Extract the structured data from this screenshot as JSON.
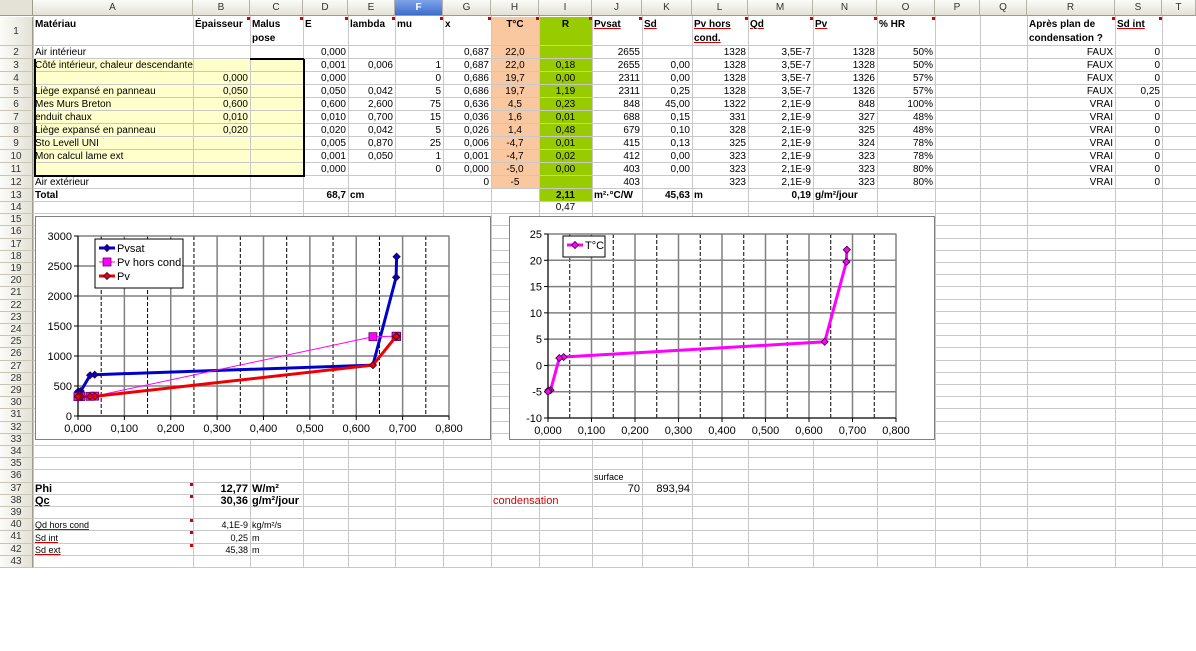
{
  "spreadsheet": {
    "columns": [
      "A",
      "B",
      "C",
      "D",
      "E",
      "F",
      "G",
      "H",
      "I",
      "J",
      "K",
      "L",
      "M",
      "N",
      "O",
      "P",
      "Q",
      "R",
      "S",
      "T"
    ],
    "selected_column": "F",
    "row_count": 43,
    "cells": {
      "A1": "Matériau",
      "B1": "Épaisseur",
      "C1": "Malus pose",
      "D1": "E",
      "E1": "lambda",
      "F1": "mu",
      "G1": "x",
      "H1": "T°C",
      "I1": "R",
      "J1": "Pvsat",
      "K1": "Sd",
      "L1": "Pv hors cond.",
      "M1": "Qd",
      "N1": "Pv",
      "O1": "% HR",
      "R1": "Après plan de condensation ?",
      "S1": "Sd int",
      "A2": "Air intérieur",
      "D2": "0,000",
      "G2": "0,687",
      "H2": "22,0",
      "J2": "2655",
      "L2": "1328",
      "M2": "3,5E-7",
      "N2": "1328",
      "O2": "50%",
      "R2": "FAUX",
      "S2": "0",
      "A3": "Côté intérieur, chaleur descendante",
      "D3": "0,001",
      "E3": "0,006",
      "F3": "1",
      "G3": "0,687",
      "H3": "22,0",
      "I3": "0,18",
      "J3": "2655",
      "K3": "0,00",
      "L3": "1328",
      "M3": "3,5E-7",
      "N3": "1328",
      "O3": "50%",
      "R3": "FAUX",
      "S3": "0",
      "B4": "0,000",
      "D4": "0,000",
      "F4": "0",
      "G4": "0,686",
      "H4": "19,7",
      "I4": "0,00",
      "J4": "2311",
      "K4": "0,00",
      "L4": "1328",
      "M4": "3,5E-7",
      "N4": "1326",
      "O4": "57%",
      "R4": "FAUX",
      "S4": "0",
      "A5": "Liège expansé en panneau",
      "B5": "0,050",
      "D5": "0,050",
      "E5": "0,042",
      "F5": "5",
      "G5": "0,686",
      "H5": "19,7",
      "I5": "1,19",
      "J5": "2311",
      "K5": "0,25",
      "L5": "1328",
      "M5": "3,5E-7",
      "N5": "1326",
      "O5": "57%",
      "R5": "FAUX",
      "S5": "0,25",
      "A6": "Mes Murs Breton",
      "B6": "0,600",
      "D6": "0,600",
      "E6": "2,600",
      "F6": "75",
      "G6": "0,636",
      "H6": "4,5",
      "I6": "0,23",
      "J6": "848",
      "K6": "45,00",
      "L6": "1322",
      "M6": "2,1E-9",
      "N6": "848",
      "O6": "100%",
      "R6": "VRAI",
      "S6": "0",
      "A7": "enduit chaux",
      "B7": "0,010",
      "D7": "0,010",
      "E7": "0,700",
      "F7": "15",
      "G7": "0,036",
      "H7": "1,6",
      "I7": "0,01",
      "J7": "688",
      "K7": "0,15",
      "L7": "331",
      "M7": "2,1E-9",
      "N7": "327",
      "O7": "48%",
      "R7": "VRAI",
      "S7": "0",
      "A8": "Liège expansé en panneau",
      "B8": "0,020",
      "D8": "0,020",
      "E8": "0,042",
      "F8": "5",
      "G8": "0,026",
      "H8": "1,4",
      "I8": "0,48",
      "J8": "679",
      "K8": "0,10",
      "L8": "328",
      "M8": "2,1E-9",
      "N8": "325",
      "O8": "48%",
      "R8": "VRAI",
      "S8": "0",
      "A9": "Sto Levell UNI",
      "D9": "0,005",
      "E9": "0,870",
      "F9": "25",
      "G9": "0,006",
      "H9": "-4,7",
      "I9": "0,01",
      "J9": "415",
      "K9": "0,13",
      "L9": "325",
      "M9": "2,1E-9",
      "N9": "324",
      "O9": "78%",
      "R9": "VRAI",
      "S9": "0",
      "A10": "Mon calcul lame ext",
      "D10": "0,001",
      "E10": "0,050",
      "F10": "1",
      "G10": "0,001",
      "H10": "-4,7",
      "I10": "0,02",
      "J10": "412",
      "K10": "0,00",
      "L10": "323",
      "M10": "2,1E-9",
      "N10": "323",
      "O10": "78%",
      "R10": "VRAI",
      "S10": "0",
      "D11": "0,000",
      "F11": "0",
      "G11": "0,000",
      "H11": "-5,0",
      "I11": "0,00",
      "J11": "403",
      "K11": "0,00",
      "L11": "323",
      "M11": "2,1E-9",
      "N11": "323",
      "O11": "80%",
      "R11": "VRAI",
      "S11": "0",
      "A12": "Air extérieur",
      "G12": "0",
      "H12": "-5",
      "J12": "403",
      "L12": "323",
      "M12": "2,1E-9",
      "N12": "323",
      "O12": "80%",
      "R12": "VRAI",
      "S12": "0",
      "A13": "Total",
      "D13": "68,7",
      "E13": "cm",
      "I13": "2,11",
      "J13": "m²·°C/W",
      "K13": "45,63",
      "L13": "m",
      "M13": "0,19",
      "N13": "g/m²/jour",
      "I14": "0,47",
      "J36": "surface",
      "A37": "Phi",
      "B37": "12,77",
      "C37": "W/m²",
      "J37": "70",
      "K37": "893,94",
      "A38": "Qc",
      "B38": "30,36",
      "C38": "g/m²/jour",
      "H38": "condensation",
      "A40": "Qd hors cond",
      "B40": "4,1E-9",
      "C40": "kg/m²/s",
      "A41": "Sd int",
      "B41": "0,25",
      "C41": "m",
      "A42": "Sd ext",
      "B42": "45,38",
      "C42": "m"
    }
  },
  "colors": {
    "input_fill": "#ffffcc",
    "temperature_column": "#fac8a0",
    "resistance_column": "#99cc00",
    "accent_selected": "#3d6dcc",
    "comment_marker": "#d00000"
  },
  "chart_data": [
    {
      "type": "scatter",
      "title": "",
      "xlabel": "",
      "ylabel": "",
      "xlim": [
        0,
        0.8
      ],
      "ylim": [
        0,
        3000
      ],
      "xticks": [
        "0,000",
        "0,100",
        "0,200",
        "0,300",
        "0,400",
        "0,500",
        "0,600",
        "0,700",
        "0,800"
      ],
      "yticks": [
        "0",
        "500",
        "1000",
        "1500",
        "2000",
        "2500",
        "3000"
      ],
      "grid": true,
      "legend": "top-left",
      "series": [
        {
          "name": "Pvsat",
          "color": "#0000cc",
          "marker": "diamond",
          "x": [
            0.687,
            0.687,
            0.686,
            0.686,
            0.636,
            0.036,
            0.026,
            0.006,
            0.001,
            0.0,
            0
          ],
          "y": [
            2655,
            2655,
            2311,
            2311,
            848,
            688,
            679,
            415,
            412,
            403,
            403
          ]
        },
        {
          "name": "Pv hors cond.",
          "color": "#ff00ff",
          "marker": "square",
          "x": [
            0.687,
            0.687,
            0.686,
            0.686,
            0.636,
            0.036,
            0.026,
            0.006,
            0.001,
            0.0,
            0
          ],
          "y": [
            1328,
            1328,
            1328,
            1328,
            1322,
            331,
            328,
            325,
            323,
            323,
            323
          ]
        },
        {
          "name": "Pv",
          "color": "#ee0000",
          "marker": "diamond",
          "x": [
            0.687,
            0.687,
            0.686,
            0.686,
            0.636,
            0.036,
            0.026,
            0.006,
            0.001,
            0.0,
            0
          ],
          "y": [
            1328,
            1328,
            1326,
            1326,
            848,
            327,
            325,
            324,
            323,
            323,
            323
          ]
        }
      ]
    },
    {
      "type": "scatter",
      "title": "",
      "xlabel": "",
      "ylabel": "",
      "xlim": [
        0,
        0.8
      ],
      "ylim": [
        -10,
        25
      ],
      "xticks": [
        "0,000",
        "0,100",
        "0,200",
        "0,300",
        "0,400",
        "0,500",
        "0,600",
        "0,700",
        "0,800"
      ],
      "yticks": [
        "-10",
        "-5",
        "0",
        "5",
        "10",
        "15",
        "20",
        "25"
      ],
      "grid": true,
      "legend": "top-left",
      "series": [
        {
          "name": "T°C",
          "color": "#ff00ff",
          "marker": "diamond",
          "x": [
            0.687,
            0.687,
            0.686,
            0.686,
            0.636,
            0.036,
            0.026,
            0.006,
            0.001,
            0.0,
            0
          ],
          "y": [
            22.0,
            22.0,
            19.7,
            19.7,
            4.5,
            1.6,
            1.4,
            -4.7,
            -4.7,
            -5.0,
            -5
          ]
        }
      ]
    }
  ]
}
